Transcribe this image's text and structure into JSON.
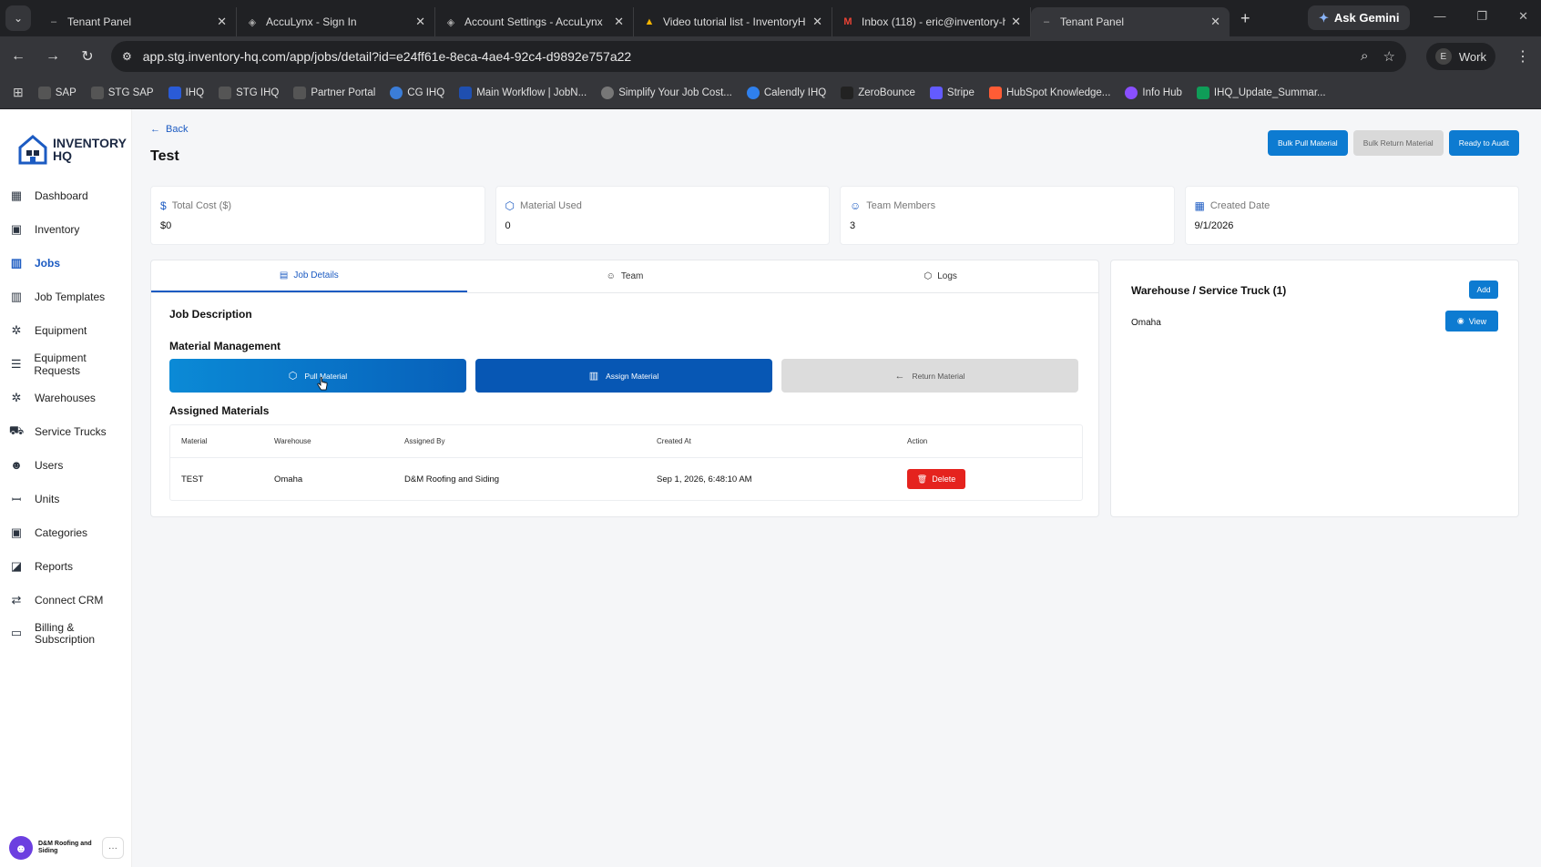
{
  "browser": {
    "tabs": [
      {
        "title": "Tenant Panel",
        "icon": "dash-icon"
      },
      {
        "title": "AccuLynx - Sign In",
        "icon": "acculynx-icon"
      },
      {
        "title": "Account Settings - AccuLynx",
        "icon": "acculynx-icon"
      },
      {
        "title": "Video tutorial list - InventoryH",
        "icon": "drive-icon"
      },
      {
        "title": "Inbox (118) - eric@inventory-h",
        "icon": "gmail-icon"
      },
      {
        "title": "Tenant Panel",
        "icon": "dash-icon"
      }
    ],
    "ask_gemini": "Ask Gemini",
    "url": "app.stg.inventory-hq.com/app/jobs/detail?id=e24ff61e-8eca-4ae4-92c4-d9892e757a22",
    "profile_initial": "E",
    "profile_label": "Work",
    "bookmarks": [
      {
        "label": "SAP",
        "color": "#555"
      },
      {
        "label": "STG SAP",
        "color": "#555"
      },
      {
        "label": "IHQ",
        "color": "#2a5bd7"
      },
      {
        "label": "STG IHQ",
        "color": "#555"
      },
      {
        "label": "Partner Portal",
        "color": "#555"
      },
      {
        "label": "CG IHQ",
        "color": "#3b7dd8"
      },
      {
        "label": "Main Workflow | JobN...",
        "color": "#1f4fb0"
      },
      {
        "label": "Simplify Your Job Cost...",
        "color": "#777"
      },
      {
        "label": "Calendly IHQ",
        "color": "#2f80ed"
      },
      {
        "label": "ZeroBounce",
        "color": "#222"
      },
      {
        "label": "Stripe",
        "color": "#635bff"
      },
      {
        "label": "HubSpot Knowledge...",
        "color": "#ff5c35"
      },
      {
        "label": "Info Hub",
        "color": "#8a4fff"
      },
      {
        "label": "IHQ_Update_Summar...",
        "color": "#0f9d58"
      }
    ]
  },
  "logo": {
    "line1": "INVENTORY",
    "line2": "HQ"
  },
  "sidebar": {
    "items": [
      {
        "label": "Dashboard",
        "icon": "grid-icon"
      },
      {
        "label": "Inventory",
        "icon": "boxes-icon"
      },
      {
        "label": "Jobs",
        "icon": "jobs-icon",
        "active": true
      },
      {
        "label": "Job Templates",
        "icon": "template-icon"
      },
      {
        "label": "Equipment",
        "icon": "tools-icon"
      },
      {
        "label": "Equipment Requests",
        "icon": "list-icon"
      },
      {
        "label": "Warehouses",
        "icon": "warehouse-icon"
      },
      {
        "label": "Service Trucks",
        "icon": "truck-icon"
      },
      {
        "label": "Users",
        "icon": "users-icon"
      },
      {
        "label": "Units",
        "icon": "units-icon"
      },
      {
        "label": "Categories",
        "icon": "categories-icon"
      },
      {
        "label": "Reports",
        "icon": "reports-icon"
      },
      {
        "label": "Connect CRM",
        "icon": "crm-icon"
      },
      {
        "label": "Billing & Subscription",
        "icon": "billing-icon"
      }
    ],
    "user_name": "D&M Roofing and Siding",
    "more": "···"
  },
  "page": {
    "back": "Back",
    "title": "Test",
    "buttons": {
      "bulk_pull": "Bulk Pull Material",
      "bulk_return": "Bulk Return Material",
      "ready_audit": "Ready to Audit"
    }
  },
  "stats": [
    {
      "label": "Total Cost ($)",
      "value": "$0",
      "icon": "dollar-icon"
    },
    {
      "label": "Material Used",
      "value": "0",
      "icon": "cube-icon"
    },
    {
      "label": "Team Members",
      "value": "3",
      "icon": "team-icon"
    },
    {
      "label": "Created Date",
      "value": "9/1/2026",
      "icon": "calendar-icon"
    }
  ],
  "tabs": {
    "job_details": "Job Details",
    "team": "Team",
    "logs": "Logs"
  },
  "job": {
    "description_heading": "Job Description",
    "material_heading": "Material Management",
    "pull_material": "Pull Material",
    "assign_material": "Assign Material",
    "return_material": "Return Material",
    "assigned_heading": "Assigned Materials",
    "table": {
      "headers": [
        "Material",
        "Warehouse",
        "Assigned By",
        "Created At",
        "Action"
      ],
      "rows": [
        {
          "material": "TEST",
          "warehouse": "Omaha",
          "assigned_by": "D&M Roofing and Siding",
          "created_at": "Sep 1, 2026, 6:48:10 AM",
          "action": "Delete"
        }
      ]
    }
  },
  "warehouse_panel": {
    "title": "Warehouse / Service Truck (1)",
    "add": "Add",
    "item": "Omaha",
    "view": "View"
  }
}
